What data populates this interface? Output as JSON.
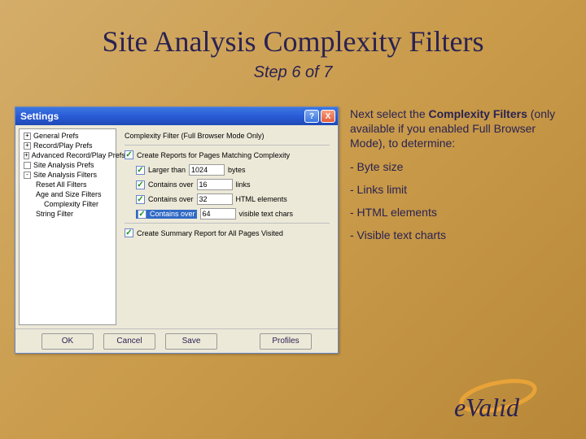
{
  "slide": {
    "title": "Site Analysis Complexity Filters",
    "subtitle": "Step 6 of 7"
  },
  "window": {
    "title": "Settings",
    "help": "?",
    "close": "X"
  },
  "tree": {
    "items": [
      {
        "label": "General Prefs",
        "expand": "+"
      },
      {
        "label": "Record/Play Prefs",
        "expand": "+"
      },
      {
        "label": "Advanced Record/Play Prefs",
        "expand": "+"
      },
      {
        "label": "Site Analysis Prefs",
        "expand": ""
      },
      {
        "label": "Site Analysis Filters",
        "expand": "-"
      }
    ],
    "subs": [
      "Reset All Filters",
      "Age and Size Filters",
      "Complexity Filter",
      "String Filter"
    ]
  },
  "panel": {
    "heading": "Complexity Filter (Full Browser Mode Only)",
    "create_reports": "Create Reports for Pages Matching Complexity",
    "rows": [
      {
        "label": "Larger than",
        "value": "1024",
        "unit": "bytes"
      },
      {
        "label": "Contains over",
        "value": "16",
        "unit": "links"
      },
      {
        "label": "Contains over",
        "value": "32",
        "unit": "HTML elements"
      },
      {
        "label": "Contains over",
        "value": "64",
        "unit": "visible text chars"
      }
    ],
    "summary": "Create Summary Report for All Pages Visited"
  },
  "buttons": {
    "ok": "OK",
    "cancel": "Cancel",
    "save": "Save",
    "profiles": "Profiles"
  },
  "copy": {
    "intro_a": "Next select the ",
    "intro_bold": "Complexity Filters",
    "intro_b": " (only available if you enabled Full Browser Mode), to determine:",
    "bullets": [
      "- Byte size",
      "- Links limit",
      "- HTML elements",
      "- Visible text charts"
    ]
  },
  "logo": {
    "text": "eValid"
  }
}
